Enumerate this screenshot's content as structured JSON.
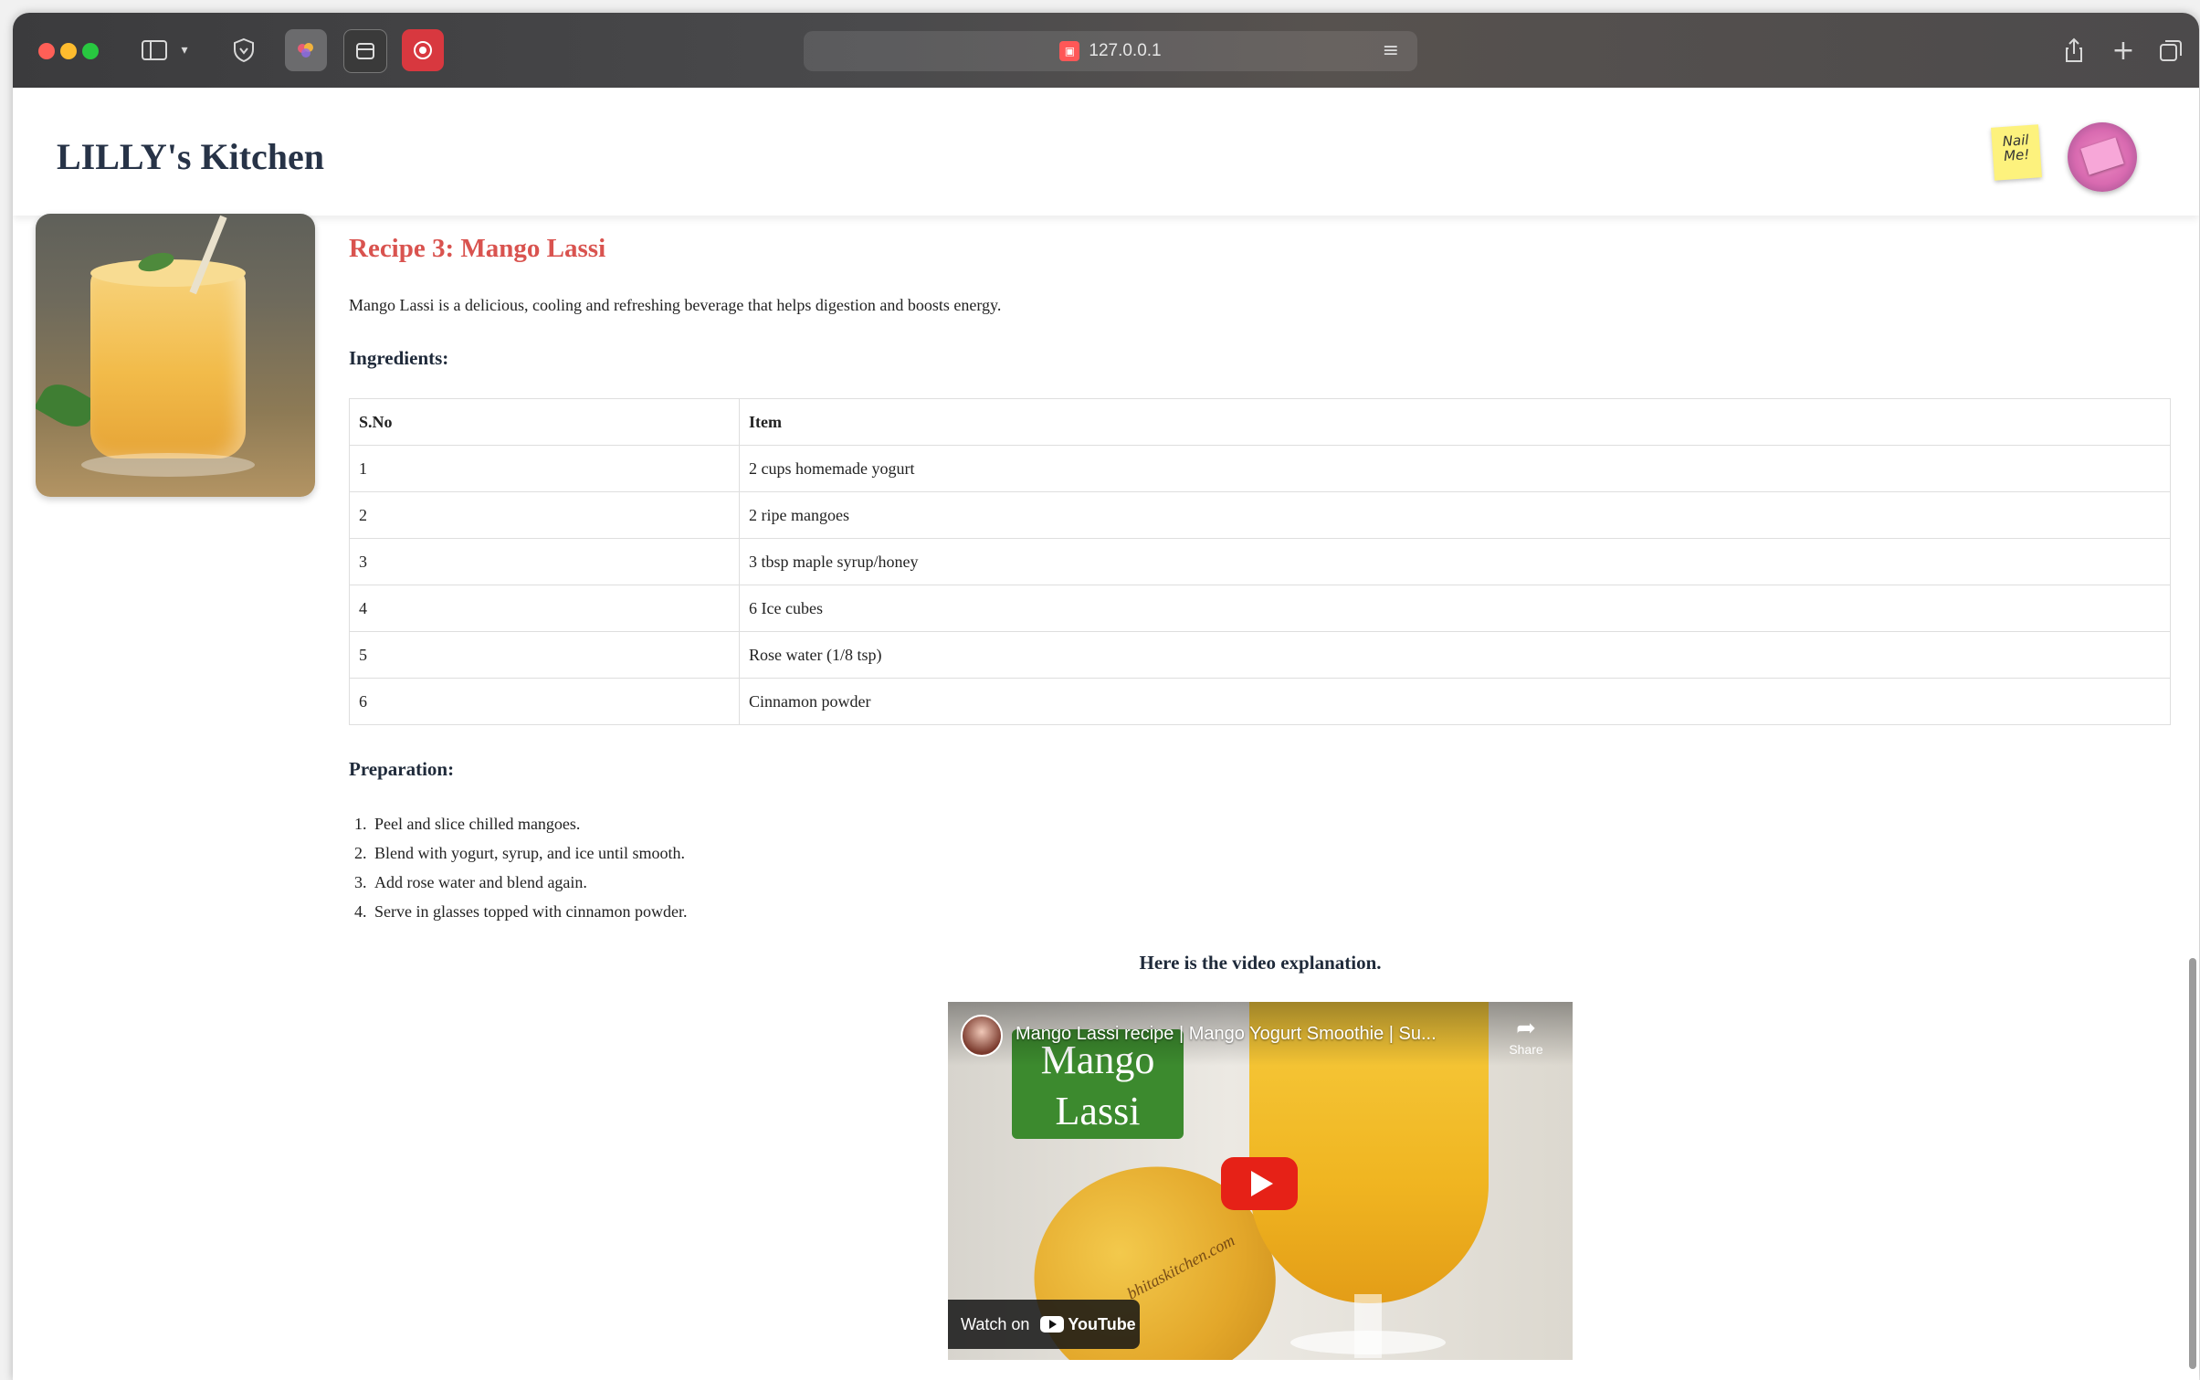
{
  "browser": {
    "address": "127.0.0.1",
    "colors": {
      "close": "#ff5f57",
      "minimize": "#febc2e",
      "maximize": "#28c840"
    }
  },
  "header": {
    "site_title": "LILLY's Kitchen",
    "sticky_note": "Nail Me!"
  },
  "recipe": {
    "title": "Recipe 3: Mango Lassi",
    "description": "Mango Lassi is a delicious, cooling and refreshing beverage that helps digestion and boosts energy.",
    "ingredients_heading": "Ingredients:",
    "table": {
      "headers": [
        "S.No",
        "Item"
      ],
      "rows": [
        [
          "1",
          "2 cups homemade yogurt"
        ],
        [
          "2",
          "2 ripe mangoes"
        ],
        [
          "3",
          "3 tbsp maple syrup/honey"
        ],
        [
          "4",
          "6 Ice cubes"
        ],
        [
          "5",
          "Rose water (1/8 tsp)"
        ],
        [
          "6",
          "Cinnamon powder"
        ]
      ]
    },
    "preparation_heading": "Preparation:",
    "steps": [
      "Peel and slice chilled mangoes.",
      "Blend with yogurt, syrup, and ice until smooth.",
      "Add rose water and blend again.",
      "Serve in glasses topped with cinnamon powder."
    ],
    "video_caption": "Here is the video explanation.",
    "video": {
      "title": "Mango Lassi recipe | Mango Yogurt Smoothie | Su...",
      "thumbnail_label": "Mango Lassi",
      "share_label": "Share",
      "watch_on": "Watch on",
      "youtube_logo": "YouTube",
      "watermark": "bhitaskitchen.com"
    },
    "accent_color": "#d9534f"
  }
}
